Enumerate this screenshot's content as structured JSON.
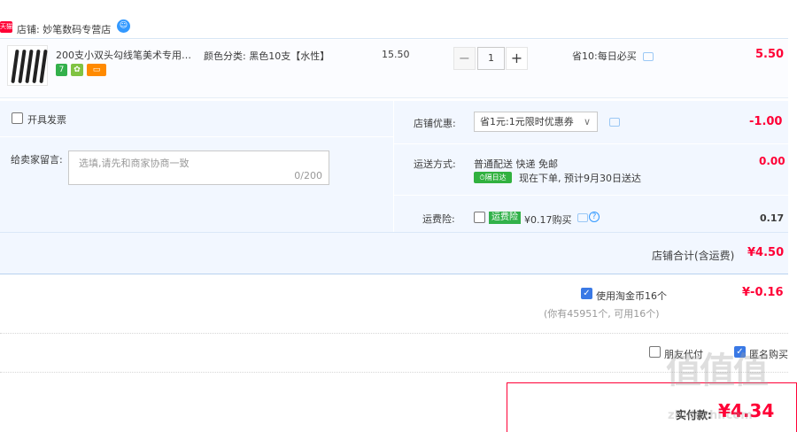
{
  "store": {
    "badge": "天猫",
    "label": "店铺: 妙笔数码专营店"
  },
  "item": {
    "title": "200支小双头勾线笔美术专用记...",
    "tags": [
      {
        "text": "7",
        "color": "#33b04b"
      },
      {
        "text": "",
        "color": "#80c342"
      },
      {
        "text": "",
        "color": "#ff8a00"
      }
    ],
    "sku": "颜色分类: 黑色10支【水性】",
    "unit_price": "15.50",
    "quantity": "1",
    "minus": "−",
    "plus": "+",
    "promo": "省10:每日必买",
    "subtotal": "5.50"
  },
  "options": {
    "invoice_label": "开具发票",
    "message_label": "给卖家留言:",
    "message_placeholder": "选填,请先和商家协商一致",
    "message_count": "0/200",
    "coupon_label": "店铺优惠:",
    "coupon_value": "省1元:1元限时优惠券",
    "coupon_amount": "-1.00",
    "shipping_label": "运送方式:",
    "shipping_value": "普通配送 快递 免邮",
    "ontime_badge": "隔日达",
    "ontime_text": "现在下单, 预计9月30日送达",
    "shipping_amount": "0.00",
    "insurance_label": "运费险:",
    "insurance_tag": "运费险",
    "insurance_price": "¥0.17购买",
    "insurance_amount": "0.17"
  },
  "store_total": {
    "label": "店铺合计(含运费)",
    "amount": "¥4.50"
  },
  "coins": {
    "label": "使用淘金币16个",
    "sub": "(你有45951个, 可用16个)",
    "amount": "¥-0.16",
    "checked": true
  },
  "footer_options": {
    "friend_pay": "朋友代付",
    "anonymous": "匿名购买"
  },
  "pay": {
    "label": "实付款:",
    "amount": "¥4.34"
  },
  "watermark": {
    "logo": "值值值",
    "site": "zhidezhi.com"
  },
  "colors": {
    "accent": "#ff0036",
    "panel": "#f2f7ff",
    "check": "#3a79e5"
  }
}
